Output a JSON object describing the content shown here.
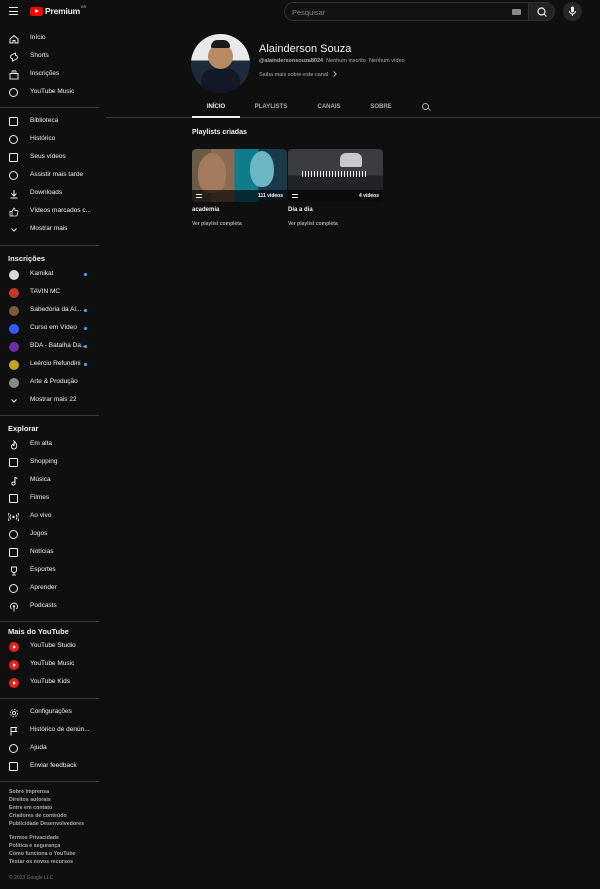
{
  "header": {
    "logo_text": "Premium",
    "logo_badge": "BR",
    "search_placeholder": "Pesquisar"
  },
  "sidebar": {
    "main": [
      {
        "label": "Início",
        "icon": "home-icon"
      },
      {
        "label": "Shorts",
        "icon": "shorts-icon"
      },
      {
        "label": "Inscrições",
        "icon": "subscriptions-icon"
      },
      {
        "label": "YouTube Music",
        "icon": "music-icon"
      }
    ],
    "library": [
      {
        "label": "Biblioteca",
        "icon": "library-icon"
      },
      {
        "label": "Histórico",
        "icon": "history-icon"
      },
      {
        "label": "Seus vídeos",
        "icon": "your-videos-icon"
      },
      {
        "label": "Assistir mais tarde",
        "icon": "watch-later-icon"
      },
      {
        "label": "Downloads",
        "icon": "download-icon"
      },
      {
        "label": "Vídeos marcados c...",
        "icon": "like-icon"
      },
      {
        "label": "Mostrar mais",
        "icon": "chevron-down-icon"
      }
    ],
    "subscriptions_title": "Inscrições",
    "subscriptions": [
      {
        "label": "Kamikat",
        "new": true,
        "color": "#d9d9d9"
      },
      {
        "label": "TAVIN MC",
        "new": false,
        "color": "#c0392b"
      },
      {
        "label": "Sabedoria da Al...",
        "new": true,
        "color": "#7a5a3a"
      },
      {
        "label": "Curso em Vídeo",
        "new": true,
        "color": "#2f5bff"
      },
      {
        "label": "BDA - Batalha Da...",
        "new": true,
        "color": "#6a2fa0"
      },
      {
        "label": "Leércio Refundini",
        "new": true,
        "color": "#c8a024"
      },
      {
        "label": "Arte & Produção",
        "new": false,
        "color": "#888888"
      },
      {
        "label": "Mostrar mais 22",
        "new": false,
        "color": ""
      }
    ],
    "explore_title": "Explorar",
    "explore": [
      {
        "label": "Em alta",
        "icon": "trending-icon"
      },
      {
        "label": "Shopping",
        "icon": "shopping-icon"
      },
      {
        "label": "Música",
        "icon": "music-note-icon"
      },
      {
        "label": "Filmes",
        "icon": "movies-icon"
      },
      {
        "label": "Ao vivo",
        "icon": "live-icon"
      },
      {
        "label": "Jogos",
        "icon": "gaming-icon"
      },
      {
        "label": "Notícias",
        "icon": "news-icon"
      },
      {
        "label": "Esportes",
        "icon": "trophy-icon"
      },
      {
        "label": "Aprender",
        "icon": "learning-icon"
      },
      {
        "label": "Podcasts",
        "icon": "podcast-icon"
      }
    ],
    "more_title": "Mais do YouTube",
    "more": [
      {
        "label": "YouTube Studio"
      },
      {
        "label": "YouTube Music"
      },
      {
        "label": "YouTube Kids"
      }
    ],
    "settings": [
      {
        "label": "Configurações",
        "icon": "gear-icon"
      },
      {
        "label": "Histórico de denún...",
        "icon": "flag-icon"
      },
      {
        "label": "Ajuda",
        "icon": "help-icon"
      },
      {
        "label": "Enviar feedback",
        "icon": "feedback-icon"
      }
    ],
    "footer1": [
      "Sobre  Imprensa",
      "Direitos autorais",
      "Entre em contato",
      "Criadores de conteúdo",
      "Publicidade  Desenvolvedores"
    ],
    "footer2": [
      "Termos  Privacidade",
      "Política e segurança",
      "Como funciona o YouTube",
      "Testar os novos recursos"
    ],
    "copyright": "© 2023 Google LLC"
  },
  "channel": {
    "name": "Alainderson Souza",
    "handle": "@alaindersonsouza8024",
    "subscribers": "Nenhum inscrito",
    "videos": "Nenhum vídeo",
    "about": "Saiba mais sobre este canal",
    "tabs": [
      "INÍCIO",
      "PLAYLISTS",
      "CANAIS",
      "SOBRE"
    ],
    "active_tab": "INÍCIO"
  },
  "playlists": {
    "section_title": "Playlists criadas",
    "items": [
      {
        "name": "academia",
        "count": "111 vídeos",
        "link": "Ver playlist completa"
      },
      {
        "name": "Dia a dia",
        "count": "4 vídeos",
        "link": "Ver playlist completa"
      }
    ]
  }
}
